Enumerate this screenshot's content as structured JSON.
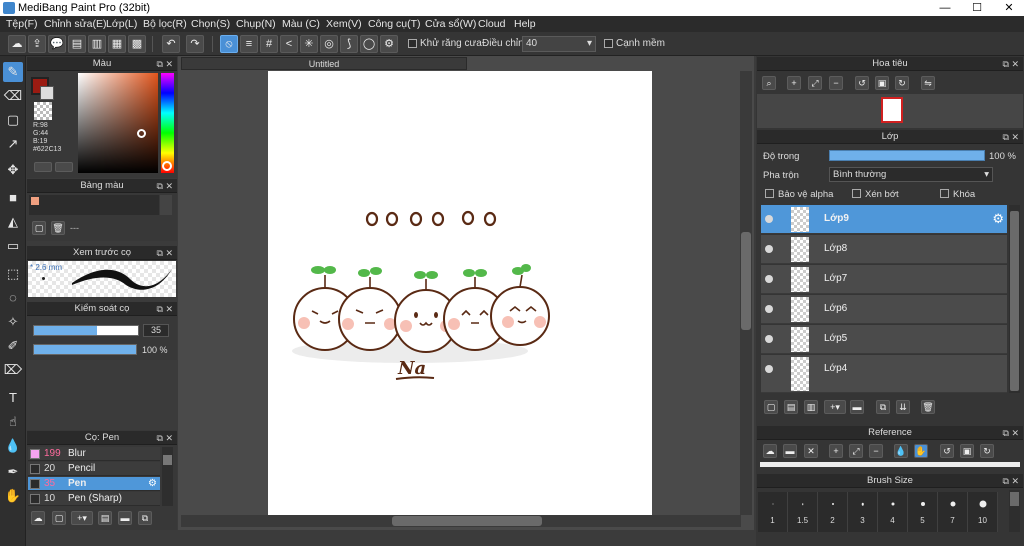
{
  "window": {
    "title": "MediBang Paint Pro (32bit)",
    "minimize": "—",
    "maximize": "☐",
    "close": "✕"
  },
  "menu": [
    "Tệp(F)",
    "Chỉnh sửa(E)",
    "Lớp(L)",
    "Bộ lọc(R)",
    "Chọn(S)",
    "Chụp(N)",
    "Màu (C)",
    "Xem(V)",
    "Công cụ(T)",
    "Cửa sổ(W)",
    "Cloud",
    "Help"
  ],
  "toolbar": {
    "antialias_label": "Khử răng cưa",
    "adjust_label": "Điều chỉnh",
    "adjust_value": "40",
    "edge_label": "Cạnh mềm"
  },
  "color_panel": {
    "title": "Màu",
    "r": "R:98",
    "g": "G:44",
    "b": "B:19",
    "hex": "#622C13",
    "fg_color": "#9a1b12"
  },
  "palette_panel": {
    "title": "Bảng màu",
    "swatch_color": "#f0a080",
    "dashes": "---"
  },
  "brush_preview_panel": {
    "title": "Xem trước cọ",
    "size": "* 2.6 mm"
  },
  "brush_control_panel": {
    "title": "Kiểm soát cọ",
    "size_value": "35",
    "opacity_value": "100 %"
  },
  "brush_list_panel": {
    "title": "Cọ: Pen",
    "items": [
      {
        "size": "199",
        "name": "Blur",
        "swatch": "#f6a4f0"
      },
      {
        "size": "20",
        "name": "Pencil",
        "swatch": "#2b2b2b"
      },
      {
        "size": "35",
        "name": "Pen",
        "swatch": "#2b2b2b"
      },
      {
        "size": "10",
        "name": "Pen (Sharp)",
        "swatch": "#2b2b2b"
      }
    ]
  },
  "document": {
    "tab_title": "Untitled",
    "sketch_text": "Na"
  },
  "navigator_panel": {
    "title": "Hoa tiêu"
  },
  "layer_panel": {
    "title": "Lớp",
    "opacity_label": "Độ trong",
    "opacity_value": "100 %",
    "blend_label": "Pha trộn",
    "blend_value": "Bình thường",
    "protect_alpha": "Bảo vệ alpha",
    "clipping": "Xén bớt",
    "lock": "Khóa",
    "layers": [
      "Lớp9",
      "Lớp8",
      "Lớp7",
      "Lớp6",
      "Lớp5",
      "Lớp4"
    ]
  },
  "reference_panel": {
    "title": "Reference"
  },
  "brush_size_panel": {
    "title": "Brush Size",
    "sizes": [
      "1",
      "1.5",
      "2",
      "3",
      "4",
      "5",
      "7",
      "10"
    ]
  }
}
